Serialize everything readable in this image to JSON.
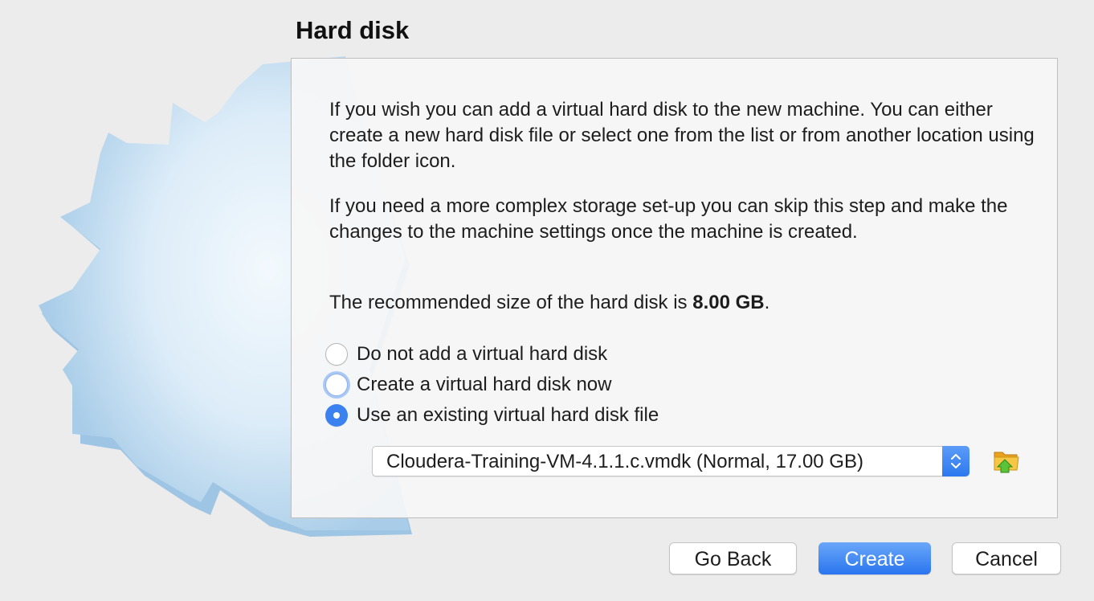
{
  "window": {
    "title": "Hard disk"
  },
  "description": {
    "paragraph1": "If you wish you can add a virtual hard disk to the new machine. You can either create a new hard disk file or select one from the list or from another location using the folder icon.",
    "paragraph2": "If you need a more complex storage set-up you can skip this step and make the changes to the machine settings once the machine is created.",
    "recommended_prefix": "The recommended size of the hard disk is ",
    "recommended_size": "8.00 GB",
    "recommended_suffix": "."
  },
  "options": {
    "items": [
      {
        "label": "Do not add a virtual hard disk",
        "checked": false
      },
      {
        "label": "Create a virtual hard disk now",
        "checked": false,
        "focused": true
      },
      {
        "label": "Use an existing virtual hard disk file",
        "checked": true
      }
    ]
  },
  "disk_select": {
    "value": "Cloudera-Training-VM-4.1.1.c.vmdk (Normal, 17.00 GB)",
    "stepper_icon": "up-down-chevron-icon",
    "folder_icon": "folder-icon"
  },
  "buttons": {
    "back": "Go Back",
    "create": "Create",
    "cancel": "Cancel"
  },
  "colors": {
    "accent": "#3b82f0",
    "background": "#ececec",
    "star": "#d8eaf7"
  }
}
